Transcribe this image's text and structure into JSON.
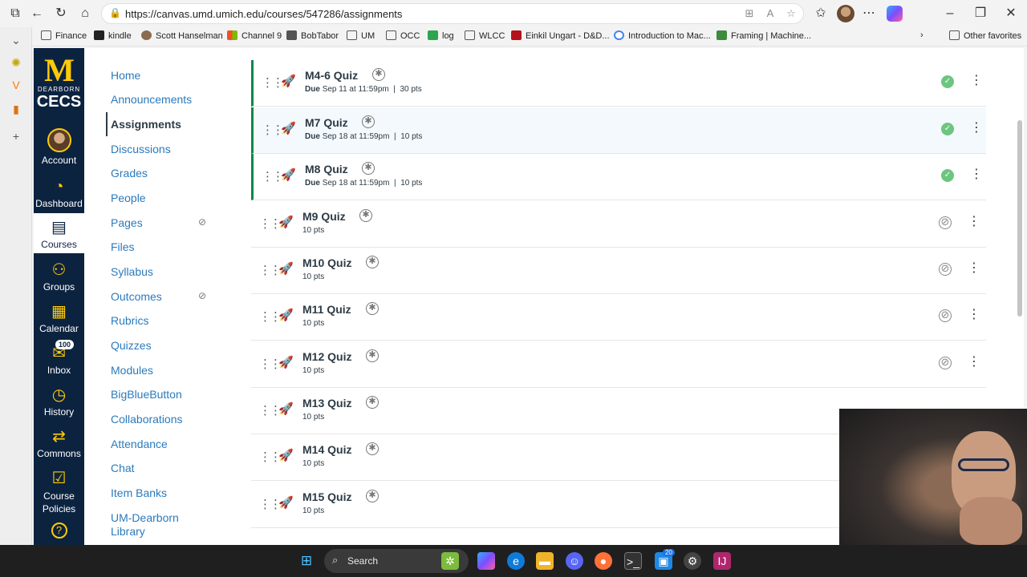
{
  "browser": {
    "url": "https://canvas.umd.umich.edu/courses/547286/assignments",
    "favorites": [
      "Finance",
      "kindle",
      "Scott Hanselman",
      "Channel 9",
      "BobTabor",
      "UM",
      "OCC",
      "log",
      "WLCC",
      "Einkil Ungart - D&D...",
      "Introduction to Mac...",
      "Framing | Machine...",
      "Other favorites"
    ]
  },
  "global_nav": {
    "logo_letter": "M",
    "logo_sub": "DEARBORN",
    "logo_cecs": "CECS",
    "items": [
      "Account",
      "Dashboard",
      "Courses",
      "Groups",
      "Calendar",
      "Inbox",
      "History",
      "Commons",
      "Course Policies"
    ],
    "inbox_count": "100"
  },
  "course_nav": {
    "items": [
      "Home",
      "Announcements",
      "Assignments",
      "Discussions",
      "Grades",
      "People",
      "Pages",
      "Files",
      "Syllabus",
      "Outcomes",
      "Rubrics",
      "Quizzes",
      "Modules",
      "BigBlueButton",
      "Collaborations",
      "Attendance",
      "Chat",
      "Item Banks",
      "UM-Dearborn Library"
    ]
  },
  "assignments": [
    {
      "title": "M4-6 Quiz",
      "due_label": "Due",
      "due": "Sep 11 at 11:59pm",
      "sep": "|",
      "pts": "30 pts",
      "published": true
    },
    {
      "title": "M7 Quiz",
      "due_label": "Due",
      "due": "Sep 18 at 11:59pm",
      "sep": "|",
      "pts": "10 pts",
      "published": true
    },
    {
      "title": "M8 Quiz",
      "due_label": "Due",
      "due": "Sep 18 at 11:59pm",
      "sep": "|",
      "pts": "10 pts",
      "published": true
    },
    {
      "title": "M9 Quiz",
      "pts": "10 pts",
      "published": false
    },
    {
      "title": "M10 Quiz",
      "pts": "10 pts",
      "published": false
    },
    {
      "title": "M11 Quiz",
      "pts": "10 pts",
      "published": false
    },
    {
      "title": "M12 Quiz",
      "pts": "10 pts",
      "published": false
    },
    {
      "title": "M13 Quiz",
      "pts": "10 pts",
      "published": false
    },
    {
      "title": "M14 Quiz",
      "pts": "10 pts",
      "published": false
    },
    {
      "title": "M15 Quiz",
      "pts": "10 pts",
      "published": false
    }
  ],
  "taskbar": {
    "search_label": "Search",
    "badge": "20"
  },
  "colors": {
    "canvas_nav": "#0c2340",
    "maize": "#ffcb05",
    "link": "#2b7abc",
    "published_green": "#0b874b"
  }
}
